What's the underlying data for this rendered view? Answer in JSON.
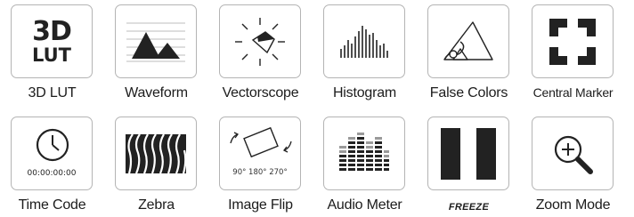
{
  "tiles": [
    {
      "label": "3D LUT",
      "icon": "3d-lut-icon",
      "icon_text_1": "3D",
      "icon_text_2": "LUT"
    },
    {
      "label": "Waveform",
      "icon": "waveform-icon"
    },
    {
      "label": "Vectorscope",
      "icon": "vectorscope-icon"
    },
    {
      "label": "Histogram",
      "icon": "histogram-icon"
    },
    {
      "label": "False Colors",
      "icon": "false-colors-icon"
    },
    {
      "label": "Central Marker",
      "icon": "central-marker-icon"
    },
    {
      "label": "Time Code",
      "icon": "time-code-icon",
      "icon_text": "00:00:00:00"
    },
    {
      "label": "Zebra",
      "icon": "zebra-icon"
    },
    {
      "label": "Image Flip",
      "icon": "image-flip-icon",
      "icon_text": "90° 180° 270°"
    },
    {
      "label": "Audio Meter",
      "icon": "audio-meter-icon"
    },
    {
      "label": "FREEZE",
      "icon": "freeze-icon"
    },
    {
      "label": "Zoom Mode",
      "icon": "zoom-mode-icon"
    }
  ],
  "colors": {
    "border": "#b4b4b4",
    "icon": "#222222",
    "text": "#1c1c1c"
  }
}
